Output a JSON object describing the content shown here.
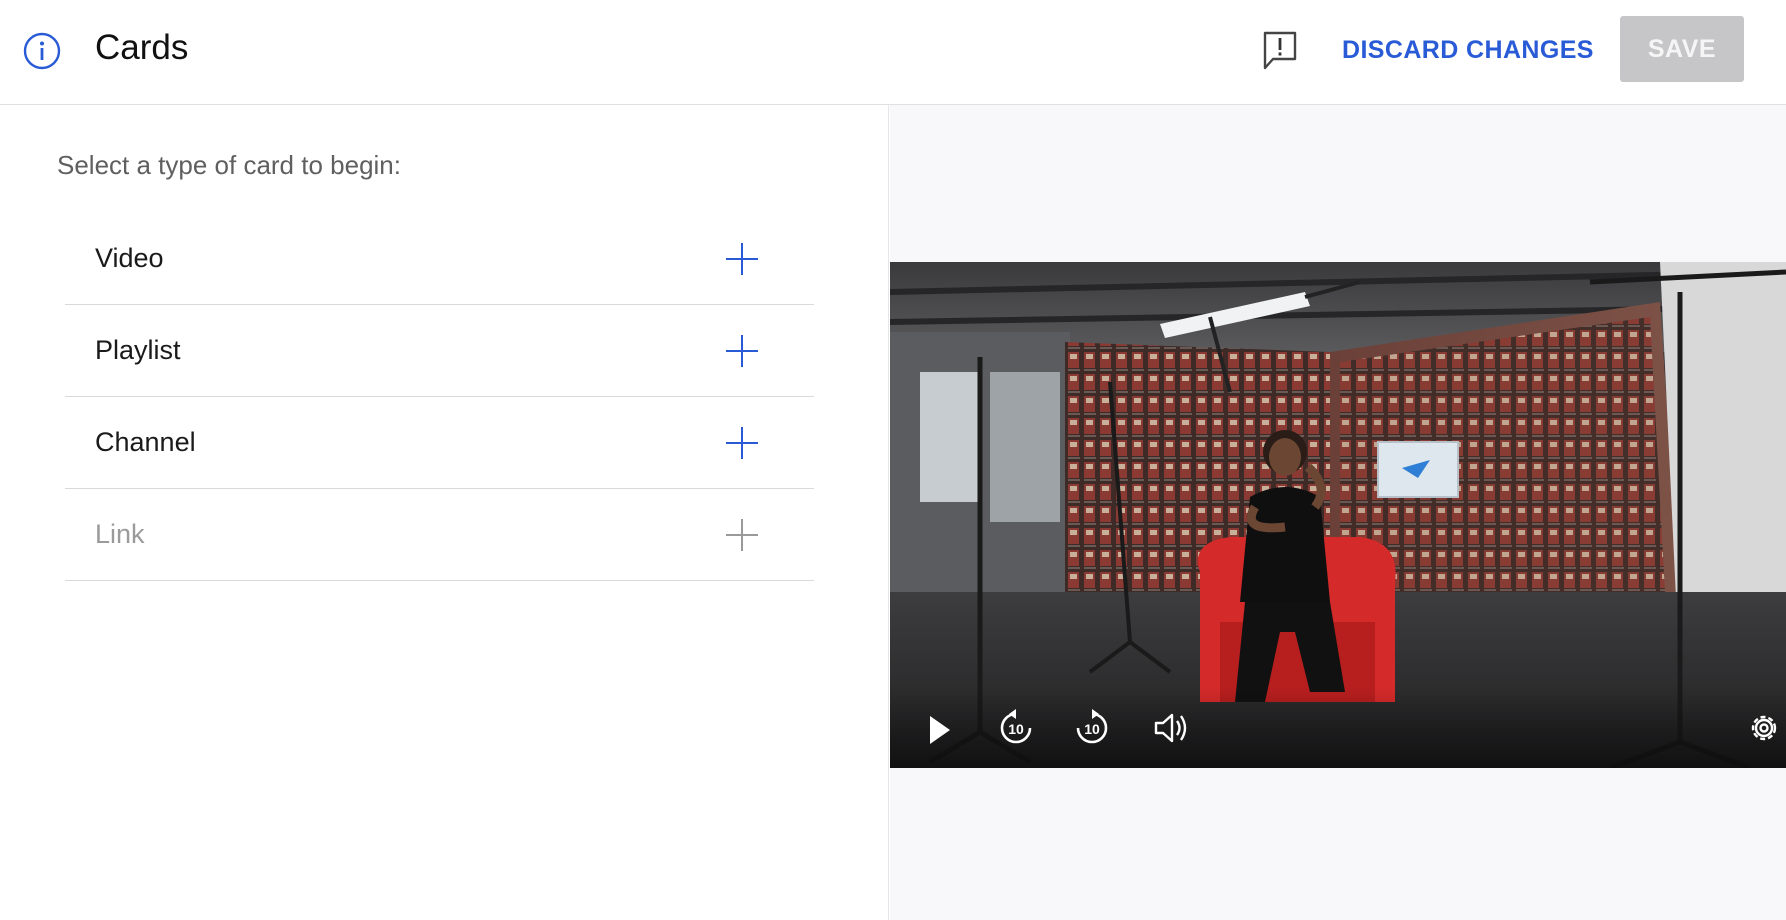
{
  "header": {
    "title": "Cards",
    "discard_label": "DISCARD CHANGES",
    "save_label": "SAVE",
    "icons": {
      "info": "info-icon",
      "feedback": "feedback-icon"
    }
  },
  "left_panel": {
    "prompt": "Select a type of card to begin:",
    "card_types": [
      {
        "label": "Video",
        "enabled": true
      },
      {
        "label": "Playlist",
        "enabled": true
      },
      {
        "label": "Channel",
        "enabled": true
      },
      {
        "label": "Link",
        "enabled": false
      }
    ]
  },
  "player": {
    "controls": [
      "play-icon",
      "rewind-10-icon",
      "forward-10-icon",
      "volume-icon",
      "settings-icon"
    ],
    "skip_seconds_back": "10",
    "skip_seconds_forward": "10"
  },
  "colors": {
    "accent": "#2a5bd7",
    "save_disabled_bg": "#c6c6c9",
    "chair": "#d42a2a",
    "divider": "#d9d9d9"
  }
}
